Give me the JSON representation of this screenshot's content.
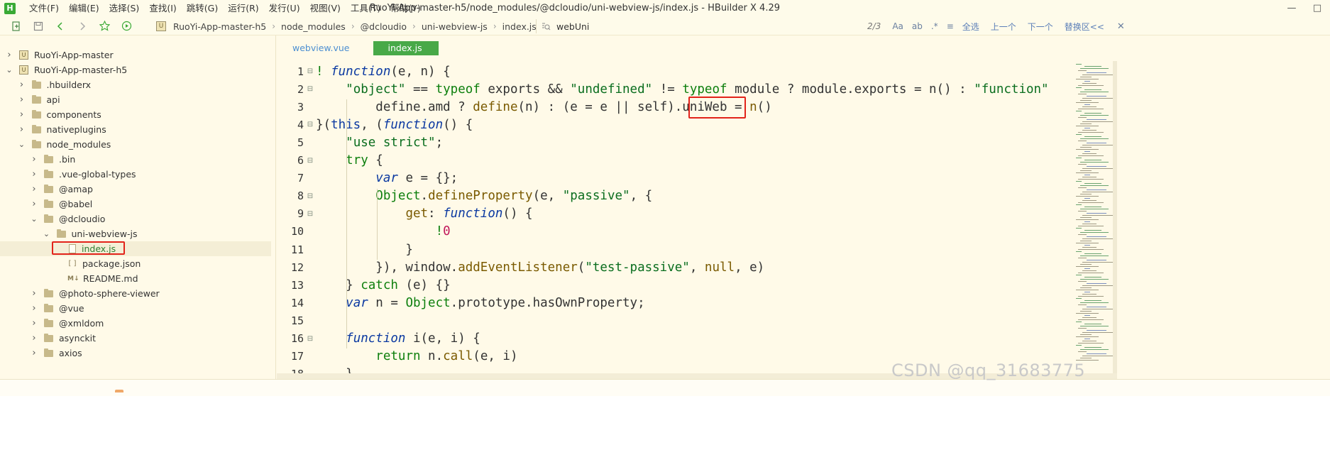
{
  "app": {
    "logo_text": "H",
    "window_title": "RuoYi-App-master-h5/node_modules/@dcloudio/uni-webview-js/index.js - HBuilder X 4.29",
    "menu": [
      "文件(F)",
      "编辑(E)",
      "选择(S)",
      "查找(I)",
      "跳转(G)",
      "运行(R)",
      "发行(U)",
      "视图(V)",
      "工具(T)",
      "帮助(Y)"
    ],
    "window_controls": [
      "—",
      "□"
    ]
  },
  "breadcrumb": [
    "RuoYi-App-master-h5",
    "node_modules",
    "@dcloudio",
    "uni-webview-js",
    "index.js"
  ],
  "find": {
    "value": "webUni",
    "count": "2/3",
    "options": [
      "Aa",
      "ab",
      ".*",
      "≡"
    ],
    "buttons": [
      "全选",
      "上一个",
      "下一个",
      "替换区<<"
    ]
  },
  "sidebar": {
    "tree": [
      {
        "label": "RuoYi-App-master",
        "type": "project",
        "depth": 0,
        "expanded": false
      },
      {
        "label": "RuoYi-App-master-h5",
        "type": "project",
        "depth": 0,
        "expanded": true
      },
      {
        "label": ".hbuilderx",
        "type": "folder",
        "depth": 1,
        "expanded": false
      },
      {
        "label": "api",
        "type": "folder",
        "depth": 1,
        "expanded": false
      },
      {
        "label": "components",
        "type": "folder",
        "depth": 1,
        "expanded": false
      },
      {
        "label": "nativeplugins",
        "type": "folder",
        "depth": 1,
        "expanded": false
      },
      {
        "label": "node_modules",
        "type": "folder",
        "depth": 1,
        "expanded": true
      },
      {
        "label": ".bin",
        "type": "folder",
        "depth": 2,
        "expanded": false
      },
      {
        "label": ".vue-global-types",
        "type": "folder",
        "depth": 2,
        "expanded": false
      },
      {
        "label": "@amap",
        "type": "folder",
        "depth": 2,
        "expanded": false
      },
      {
        "label": "@babel",
        "type": "folder",
        "depth": 2,
        "expanded": false
      },
      {
        "label": "@dcloudio",
        "type": "folder",
        "depth": 2,
        "expanded": true
      },
      {
        "label": "uni-webview-js",
        "type": "folder",
        "depth": 3,
        "expanded": true
      },
      {
        "label": "index.js",
        "type": "file",
        "depth": 4,
        "selected": true
      },
      {
        "label": "package.json",
        "type": "json",
        "depth": 4
      },
      {
        "label": "README.md",
        "type": "md",
        "depth": 4
      },
      {
        "label": "@photo-sphere-viewer",
        "type": "folder",
        "depth": 2,
        "expanded": false
      },
      {
        "label": "@vue",
        "type": "folder",
        "depth": 2,
        "expanded": false
      },
      {
        "label": "@xmldom",
        "type": "folder",
        "depth": 2,
        "expanded": false
      },
      {
        "label": "asynckit",
        "type": "folder",
        "depth": 2,
        "expanded": false
      },
      {
        "label": "axios",
        "type": "folder",
        "depth": 2,
        "expanded": false
      }
    ]
  },
  "tabs": [
    "webview.vue",
    "index.js"
  ],
  "code": [
    {
      "n": "1",
      "fold": "⊟",
      "tokens": [
        [
          "kw",
          "! "
        ],
        [
          "fn",
          "function"
        ],
        [
          "plain",
          "(e, n) {"
        ]
      ]
    },
    {
      "n": "2",
      "fold": "⊟",
      "tokens": [
        [
          "plain",
          "    "
        ],
        [
          "str",
          "\"object\""
        ],
        [
          "plain",
          " == "
        ],
        [
          "kw",
          "typeof"
        ],
        [
          "plain",
          " exports && "
        ],
        [
          "str",
          "\"undefined\""
        ],
        [
          "plain",
          " != "
        ],
        [
          "kw",
          "typeof"
        ],
        [
          "plain",
          " module ? module.exports = n() : "
        ],
        [
          "str",
          "\"function\""
        ]
      ]
    },
    {
      "n": "3",
      "fold": "",
      "tokens": [
        [
          "plain",
          "        define.amd ? "
        ],
        [
          "method",
          "define"
        ],
        [
          "plain",
          "(n) : (e = e || self)."
        ],
        [
          "plain",
          "uniWeb"
        ],
        [
          "plain",
          " = "
        ],
        [
          "method",
          "n"
        ],
        [
          "plain",
          "()"
        ]
      ]
    },
    {
      "n": "4",
      "fold": "⊟",
      "tokens": [
        [
          "plain",
          "}("
        ],
        [
          "blue",
          "this"
        ],
        [
          "plain",
          ", ("
        ],
        [
          "fn",
          "function"
        ],
        [
          "plain",
          "() {"
        ]
      ]
    },
    {
      "n": "5",
      "fold": "",
      "tokens": [
        [
          "plain",
          "    "
        ],
        [
          "str",
          "\"use strict\""
        ],
        [
          "plain",
          ";"
        ]
      ]
    },
    {
      "n": "6",
      "fold": "⊟",
      "tokens": [
        [
          "plain",
          "    "
        ],
        [
          "kw",
          "try"
        ],
        [
          "plain",
          " {"
        ]
      ]
    },
    {
      "n": "7",
      "fold": "",
      "tokens": [
        [
          "plain",
          "        "
        ],
        [
          "fn",
          "var"
        ],
        [
          "plain",
          " e = {};"
        ]
      ]
    },
    {
      "n": "8",
      "fold": "⊟",
      "tokens": [
        [
          "plain",
          "        "
        ],
        [
          "kw",
          "Object"
        ],
        [
          "plain",
          "."
        ],
        [
          "method",
          "defineProperty"
        ],
        [
          "plain",
          "(e, "
        ],
        [
          "str",
          "\"passive\""
        ],
        [
          "plain",
          ", {"
        ]
      ]
    },
    {
      "n": "9",
      "fold": "⊟",
      "tokens": [
        [
          "plain",
          "            "
        ],
        [
          "method",
          "get"
        ],
        [
          "plain",
          ": "
        ],
        [
          "fn",
          "function"
        ],
        [
          "plain",
          "() {"
        ]
      ]
    },
    {
      "n": "10",
      "fold": "",
      "tokens": [
        [
          "plain",
          "                "
        ],
        [
          "kw",
          "!"
        ],
        [
          "num",
          "0"
        ]
      ]
    },
    {
      "n": "11",
      "fold": "",
      "tokens": [
        [
          "plain",
          "            }"
        ]
      ]
    },
    {
      "n": "12",
      "fold": "",
      "tokens": [
        [
          "plain",
          "        }), window."
        ],
        [
          "method",
          "addEventListener"
        ],
        [
          "plain",
          "("
        ],
        [
          "str",
          "\"test-passive\""
        ],
        [
          "plain",
          ", "
        ],
        [
          "method",
          "null"
        ],
        [
          "plain",
          ", e)"
        ]
      ]
    },
    {
      "n": "13",
      "fold": "",
      "tokens": [
        [
          "plain",
          "    } "
        ],
        [
          "kw",
          "catch"
        ],
        [
          "plain",
          " (e) {}"
        ]
      ]
    },
    {
      "n": "14",
      "fold": "",
      "tokens": [
        [
          "plain",
          "    "
        ],
        [
          "fn",
          "var"
        ],
        [
          "plain",
          " n = "
        ],
        [
          "kw",
          "Object"
        ],
        [
          "plain",
          ".prototype.hasOwnProperty;"
        ]
      ]
    },
    {
      "n": "15",
      "fold": "",
      "tokens": []
    },
    {
      "n": "16",
      "fold": "⊟",
      "tokens": [
        [
          "plain",
          "    "
        ],
        [
          "fn",
          "function"
        ],
        [
          "plain",
          " i(e, i) {"
        ]
      ]
    },
    {
      "n": "17",
      "fold": "",
      "tokens": [
        [
          "plain",
          "        "
        ],
        [
          "kw",
          "return"
        ],
        [
          "plain",
          " n."
        ],
        [
          "method",
          "call"
        ],
        [
          "plain",
          "(e, i)"
        ]
      ]
    },
    {
      "n": "18",
      "fold": "",
      "tokens": [
        [
          "plain",
          "    }"
        ]
      ]
    }
  ],
  "watermark": "CSDN @qq_31683775",
  "colors": {
    "accent_tab": "#48a948",
    "highlight_box": "#e2231a",
    "background": "#fffae8"
  }
}
